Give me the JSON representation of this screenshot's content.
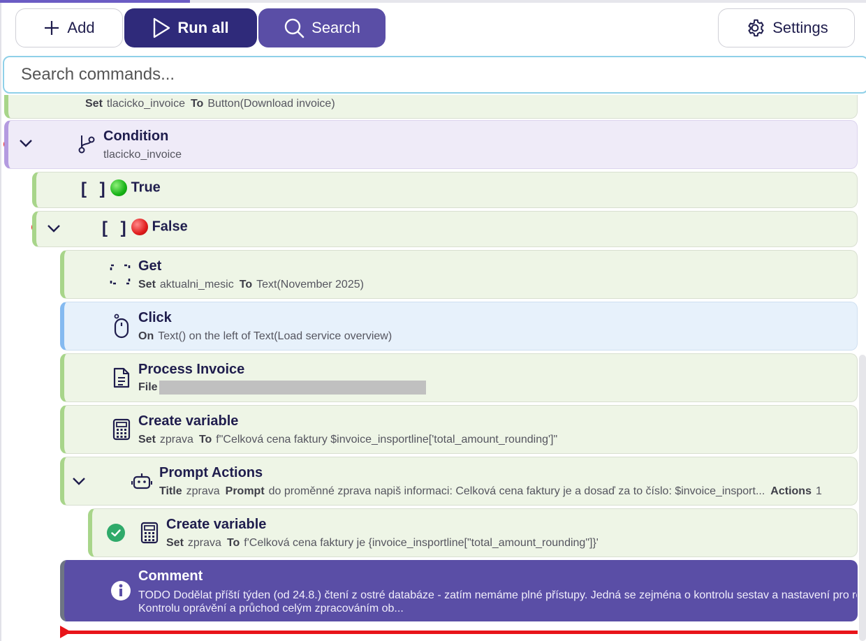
{
  "toolbar": {
    "add_label": "Add",
    "run_all_label": "Run all",
    "search_label": "Search",
    "settings_label": "Settings"
  },
  "search": {
    "placeholder": "Search commands..."
  },
  "steps": {
    "partial_set": {
      "k1": "Set",
      "v1": "tlacicko_invoice",
      "k2": "To",
      "v2": "Button(Download invoice)"
    },
    "condition": {
      "title": "Condition",
      "detail": "tlacicko_invoice"
    },
    "true_branch": {
      "title": "True"
    },
    "false_branch": {
      "title": "False"
    },
    "get": {
      "title": "Get",
      "k1": "Set",
      "v1": "aktualni_mesic",
      "k2": "To",
      "v2": "Text(November 2025)"
    },
    "click": {
      "title": "Click",
      "k1": "On",
      "v1": "Text() on the left of Text(Load service overview)"
    },
    "process_invoice": {
      "title": "Process Invoice",
      "k1": "File"
    },
    "create_variable_1": {
      "title": "Create variable",
      "k1": "Set",
      "v1": "zprava",
      "k2": "To",
      "v2": "f\"Celková cena faktury $invoice_insportline['total_amount_rounding']\""
    },
    "prompt_actions": {
      "title": "Prompt Actions",
      "k1": "Title",
      "v1": "zprava",
      "k2": "Prompt",
      "v2": "do proměnné zprava napiš informaci: Celková cena faktury je a dosaď za to číslo: $invoice_insport...",
      "k3": "Actions",
      "v3": "1"
    },
    "create_variable_2": {
      "title": "Create variable",
      "k1": "Set",
      "v1": "zprava",
      "k2": "To",
      "v2": "f'Celková cena faktury je {invoice_insportline[\"total_amount_rounding\"]}'"
    },
    "comment": {
      "title": "Comment",
      "text": "TODO Dodělat příští týden (od 24.8.) čtení z ostré databáze - zatím nemáme plné přístupy. Jedná se zejména o kontrolu sestav a nastavení pro robota. Kontrolu oprávění a průchod celým zpracováním ob..."
    }
  },
  "colors": {
    "primary_dark": "#2f2a7a",
    "primary": "#5a4ea6",
    "step_green": "#eef5e6",
    "step_purple": "#efebf8",
    "step_blue": "#e7f1fb",
    "breakpoint": "#e8141a"
  },
  "icons": [
    "plus-icon",
    "play-icon",
    "search-icon",
    "gear-icon",
    "branch-icon",
    "brackets-icon",
    "scan-icon",
    "mouse-icon",
    "document-icon",
    "calculator-icon",
    "robot-icon",
    "check-circle-icon",
    "info-icon",
    "chevron-down-icon"
  ]
}
